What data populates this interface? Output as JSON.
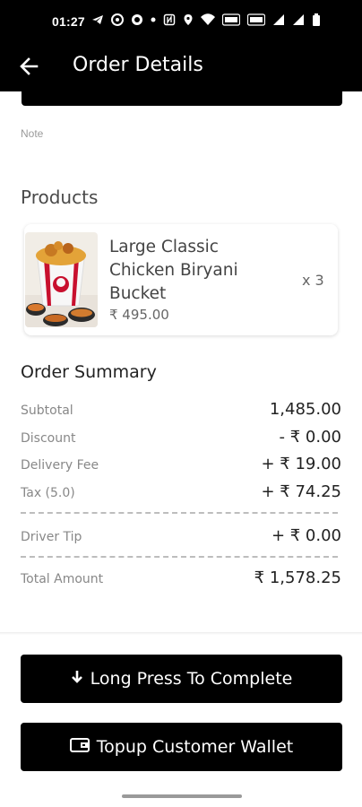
{
  "status_bar": {
    "time": "01:27",
    "icons": [
      "telegram-icon",
      "chrome-icon",
      "sync-icon",
      "dot-icon",
      "nfc-icon",
      "location-icon",
      "wifi-icon",
      "volte-icon",
      "volte-icon",
      "signal-icon",
      "signal-icon",
      "battery-icon"
    ]
  },
  "header": {
    "title": "Order Details",
    "background": "#000000"
  },
  "note": {
    "label": "Note"
  },
  "products": {
    "title": "Products",
    "items": [
      {
        "name": "Large Classic Chicken Biryani Bucket",
        "price": "₹ 495.00",
        "quantity": "x 3"
      }
    ]
  },
  "summary": {
    "title": "Order Summary",
    "rows": [
      {
        "label": "Subtotal",
        "value": "1,485.00"
      },
      {
        "label": "Discount",
        "value": "- ₹ 0.00"
      },
      {
        "label": "Delivery Fee",
        "value": "+ ₹ 19.00"
      },
      {
        "label": "Tax (5.0)",
        "value": "+ ₹ 74.25"
      },
      {
        "label": "Driver Tip",
        "value": "+ ₹ 0.00"
      },
      {
        "label": "Total Amount",
        "value": "₹ 1,578.25"
      }
    ]
  },
  "actions": {
    "complete_label": "Long Press To Complete",
    "topup_label": "Topup Customer Wallet"
  }
}
